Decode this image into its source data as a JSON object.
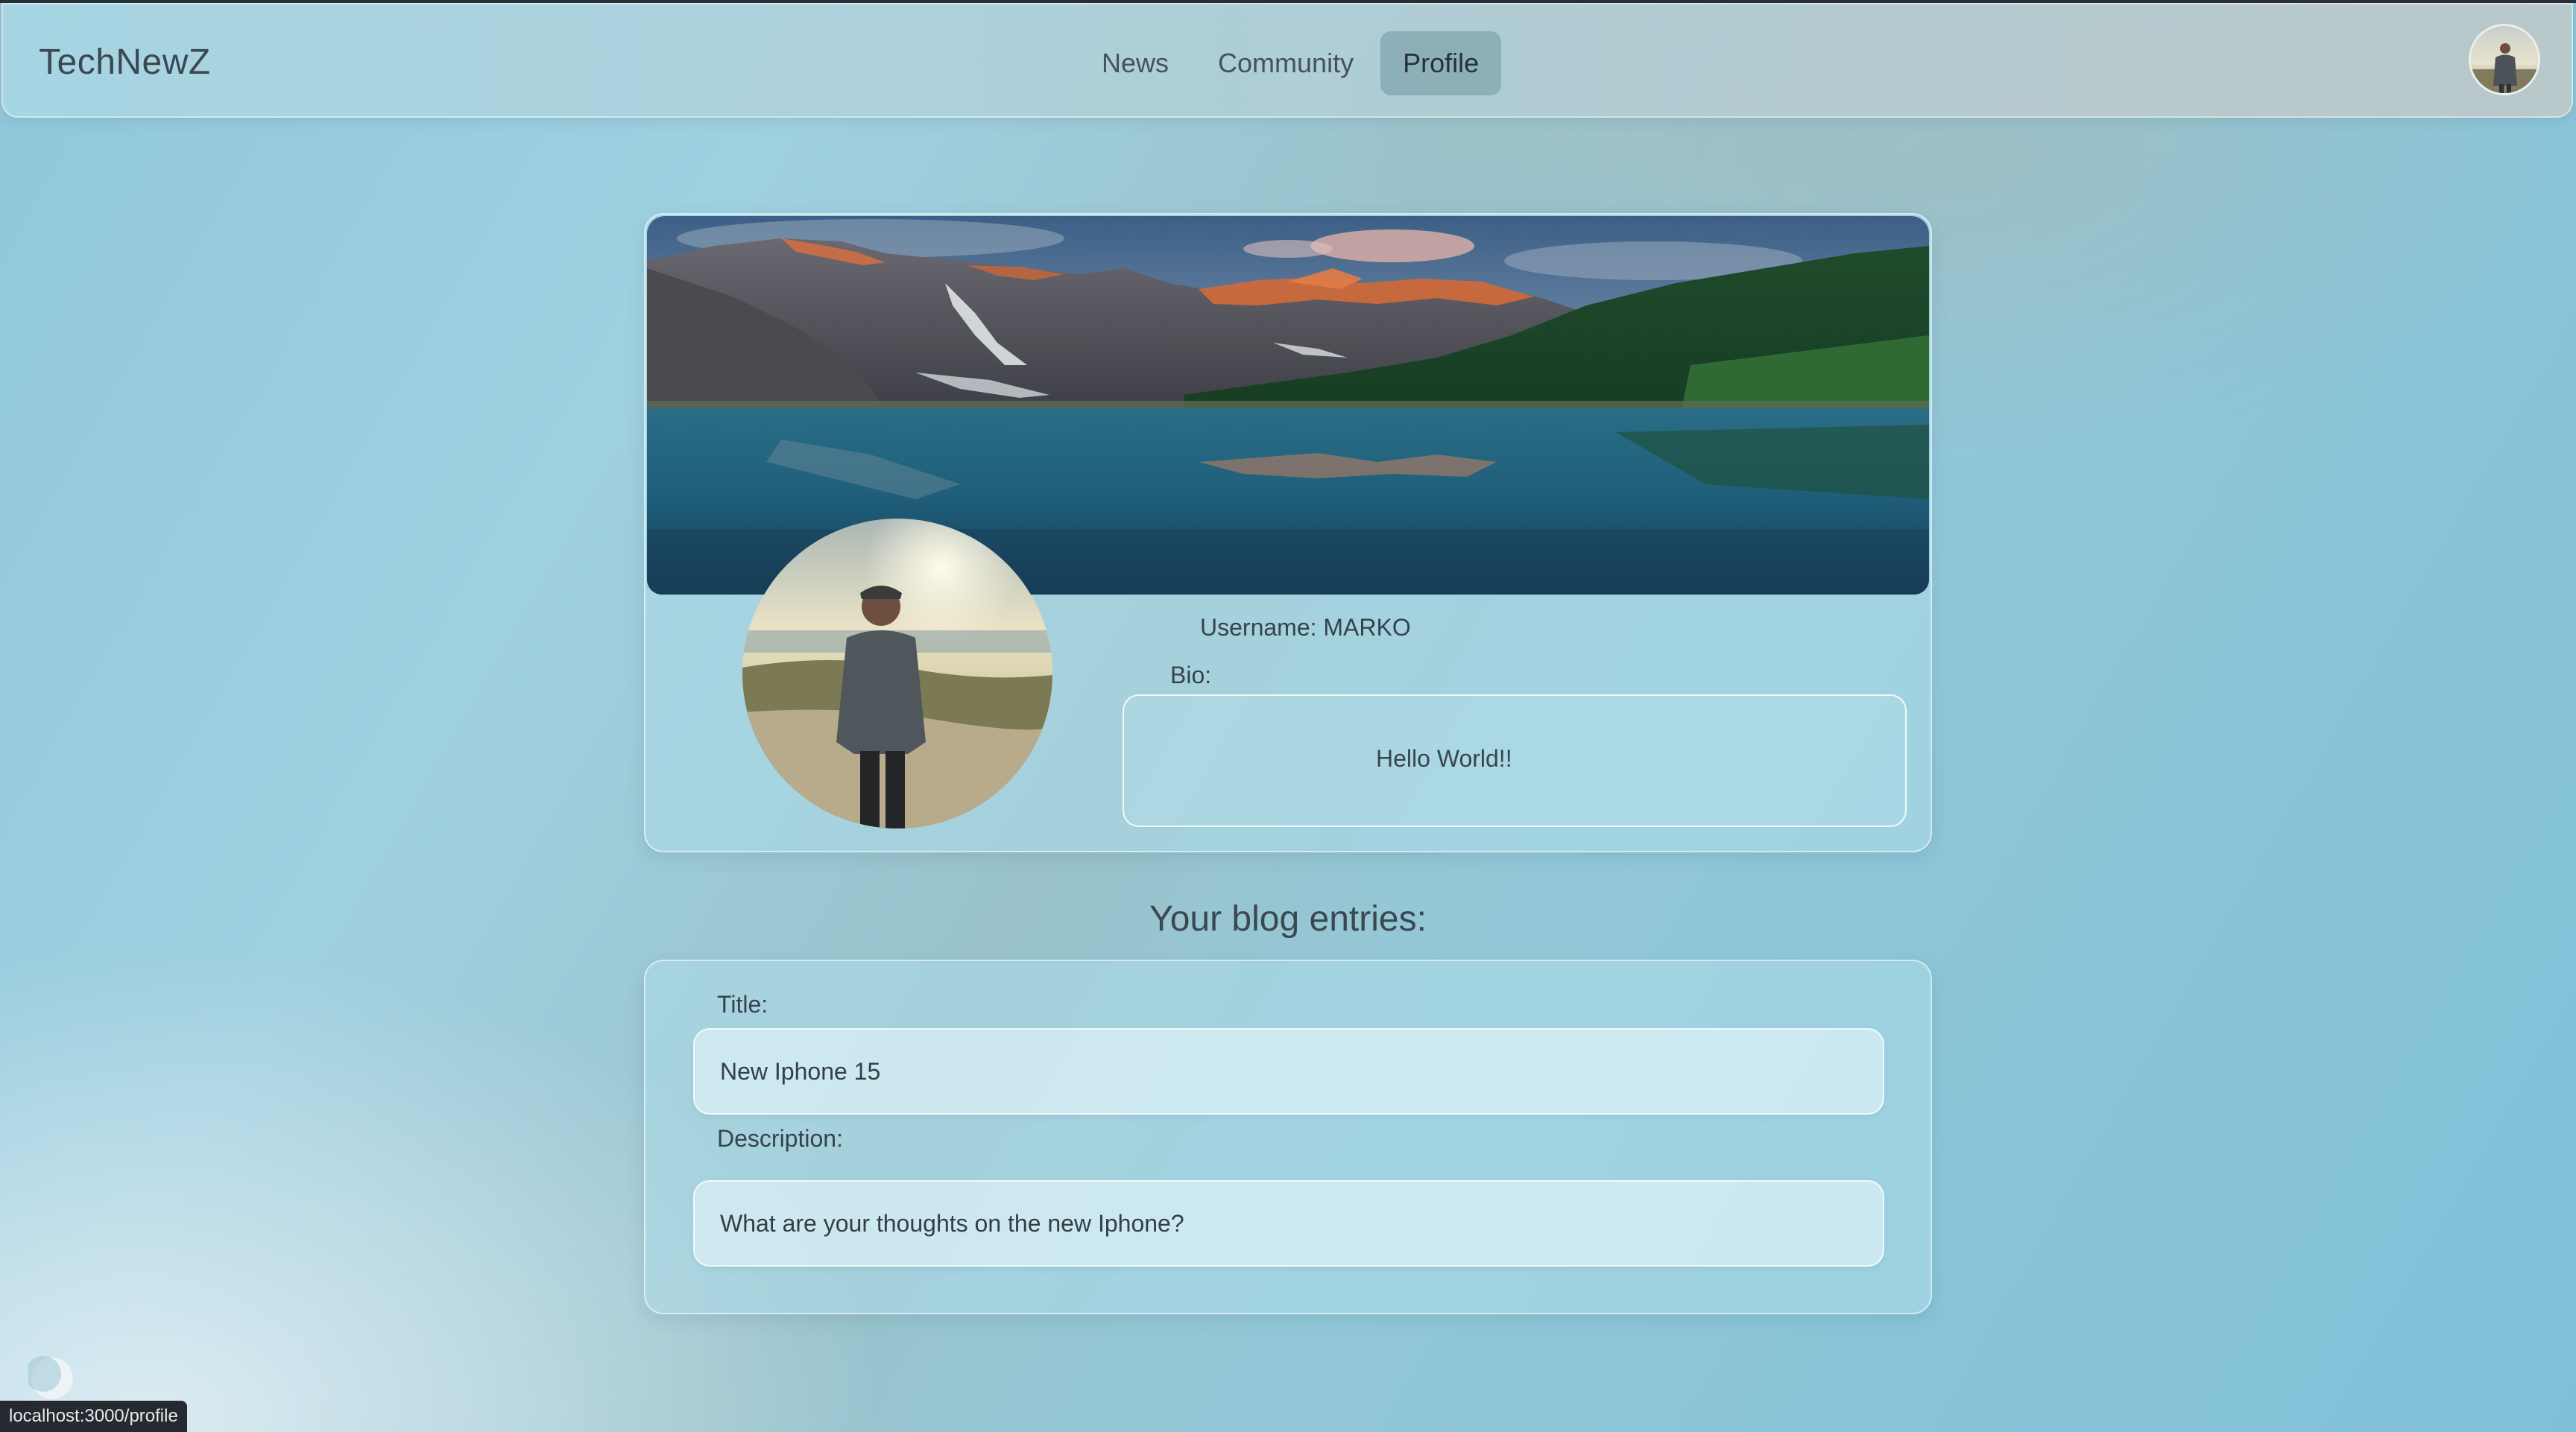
{
  "brand": "TechNewZ",
  "nav": {
    "items": [
      {
        "label": "News"
      },
      {
        "label": "Community"
      },
      {
        "label": "Profile"
      }
    ]
  },
  "profile": {
    "username_text": "Username: MARKO",
    "bio_label": "Bio:",
    "bio_text": "Hello World!!"
  },
  "blog": {
    "section_title": "Your blog entries:",
    "title_label": "Title:",
    "title_value": "New Iphone 15",
    "description_label": "Description:",
    "description_value": "What are your thoughts on the new Iphone?"
  },
  "status_bar": {
    "url": "localhost:3000/profile"
  }
}
